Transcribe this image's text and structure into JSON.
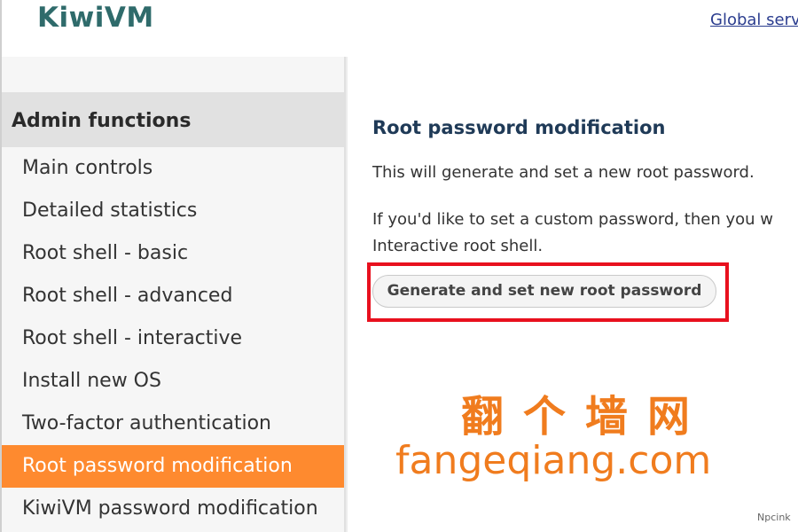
{
  "header": {
    "logo": "KiwiVM",
    "link": "Global serv"
  },
  "sidebar": {
    "heading": "Admin functions",
    "items": [
      {
        "label": "Main controls"
      },
      {
        "label": "Detailed statistics"
      },
      {
        "label": "Root shell - basic"
      },
      {
        "label": "Root shell - advanced"
      },
      {
        "label": "Root shell - interactive"
      },
      {
        "label": "Install new OS"
      },
      {
        "label": "Two-factor authentication"
      },
      {
        "label": "Root password modification",
        "active": true
      },
      {
        "label": "KiwiVM password modification"
      }
    ]
  },
  "content": {
    "title": "Root password modification",
    "p1": "This will generate and set a new root password.",
    "p2_line1": "If you'd like to set a custom password, then you w",
    "p2_line2": "Interactive root shell.",
    "button": "Generate and set new root password"
  },
  "overlay": {
    "watermark_cn": "翻个墙网",
    "watermark_en": "fangeqiang.com",
    "corner_mark": "Npcink"
  },
  "colors": {
    "accent": "#fe8a2f",
    "highlight": "#e8101e",
    "title": "#1f3a57",
    "logo": "#2f6b6b",
    "watermark": "#f07c1e"
  }
}
